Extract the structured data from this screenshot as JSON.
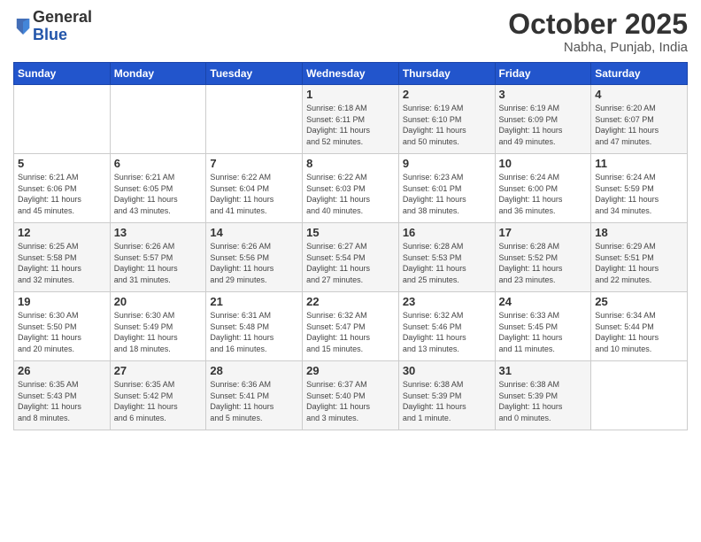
{
  "header": {
    "logo_general": "General",
    "logo_blue": "Blue",
    "month": "October 2025",
    "location": "Nabha, Punjab, India"
  },
  "days_of_week": [
    "Sunday",
    "Monday",
    "Tuesday",
    "Wednesday",
    "Thursday",
    "Friday",
    "Saturday"
  ],
  "weeks": [
    [
      {
        "num": "",
        "info": ""
      },
      {
        "num": "",
        "info": ""
      },
      {
        "num": "",
        "info": ""
      },
      {
        "num": "1",
        "info": "Sunrise: 6:18 AM\nSunset: 6:11 PM\nDaylight: 11 hours\nand 52 minutes."
      },
      {
        "num": "2",
        "info": "Sunrise: 6:19 AM\nSunset: 6:10 PM\nDaylight: 11 hours\nand 50 minutes."
      },
      {
        "num": "3",
        "info": "Sunrise: 6:19 AM\nSunset: 6:09 PM\nDaylight: 11 hours\nand 49 minutes."
      },
      {
        "num": "4",
        "info": "Sunrise: 6:20 AM\nSunset: 6:07 PM\nDaylight: 11 hours\nand 47 minutes."
      }
    ],
    [
      {
        "num": "5",
        "info": "Sunrise: 6:21 AM\nSunset: 6:06 PM\nDaylight: 11 hours\nand 45 minutes."
      },
      {
        "num": "6",
        "info": "Sunrise: 6:21 AM\nSunset: 6:05 PM\nDaylight: 11 hours\nand 43 minutes."
      },
      {
        "num": "7",
        "info": "Sunrise: 6:22 AM\nSunset: 6:04 PM\nDaylight: 11 hours\nand 41 minutes."
      },
      {
        "num": "8",
        "info": "Sunrise: 6:22 AM\nSunset: 6:03 PM\nDaylight: 11 hours\nand 40 minutes."
      },
      {
        "num": "9",
        "info": "Sunrise: 6:23 AM\nSunset: 6:01 PM\nDaylight: 11 hours\nand 38 minutes."
      },
      {
        "num": "10",
        "info": "Sunrise: 6:24 AM\nSunset: 6:00 PM\nDaylight: 11 hours\nand 36 minutes."
      },
      {
        "num": "11",
        "info": "Sunrise: 6:24 AM\nSunset: 5:59 PM\nDaylight: 11 hours\nand 34 minutes."
      }
    ],
    [
      {
        "num": "12",
        "info": "Sunrise: 6:25 AM\nSunset: 5:58 PM\nDaylight: 11 hours\nand 32 minutes."
      },
      {
        "num": "13",
        "info": "Sunrise: 6:26 AM\nSunset: 5:57 PM\nDaylight: 11 hours\nand 31 minutes."
      },
      {
        "num": "14",
        "info": "Sunrise: 6:26 AM\nSunset: 5:56 PM\nDaylight: 11 hours\nand 29 minutes."
      },
      {
        "num": "15",
        "info": "Sunrise: 6:27 AM\nSunset: 5:54 PM\nDaylight: 11 hours\nand 27 minutes."
      },
      {
        "num": "16",
        "info": "Sunrise: 6:28 AM\nSunset: 5:53 PM\nDaylight: 11 hours\nand 25 minutes."
      },
      {
        "num": "17",
        "info": "Sunrise: 6:28 AM\nSunset: 5:52 PM\nDaylight: 11 hours\nand 23 minutes."
      },
      {
        "num": "18",
        "info": "Sunrise: 6:29 AM\nSunset: 5:51 PM\nDaylight: 11 hours\nand 22 minutes."
      }
    ],
    [
      {
        "num": "19",
        "info": "Sunrise: 6:30 AM\nSunset: 5:50 PM\nDaylight: 11 hours\nand 20 minutes."
      },
      {
        "num": "20",
        "info": "Sunrise: 6:30 AM\nSunset: 5:49 PM\nDaylight: 11 hours\nand 18 minutes."
      },
      {
        "num": "21",
        "info": "Sunrise: 6:31 AM\nSunset: 5:48 PM\nDaylight: 11 hours\nand 16 minutes."
      },
      {
        "num": "22",
        "info": "Sunrise: 6:32 AM\nSunset: 5:47 PM\nDaylight: 11 hours\nand 15 minutes."
      },
      {
        "num": "23",
        "info": "Sunrise: 6:32 AM\nSunset: 5:46 PM\nDaylight: 11 hours\nand 13 minutes."
      },
      {
        "num": "24",
        "info": "Sunrise: 6:33 AM\nSunset: 5:45 PM\nDaylight: 11 hours\nand 11 minutes."
      },
      {
        "num": "25",
        "info": "Sunrise: 6:34 AM\nSunset: 5:44 PM\nDaylight: 11 hours\nand 10 minutes."
      }
    ],
    [
      {
        "num": "26",
        "info": "Sunrise: 6:35 AM\nSunset: 5:43 PM\nDaylight: 11 hours\nand 8 minutes."
      },
      {
        "num": "27",
        "info": "Sunrise: 6:35 AM\nSunset: 5:42 PM\nDaylight: 11 hours\nand 6 minutes."
      },
      {
        "num": "28",
        "info": "Sunrise: 6:36 AM\nSunset: 5:41 PM\nDaylight: 11 hours\nand 5 minutes."
      },
      {
        "num": "29",
        "info": "Sunrise: 6:37 AM\nSunset: 5:40 PM\nDaylight: 11 hours\nand 3 minutes."
      },
      {
        "num": "30",
        "info": "Sunrise: 6:38 AM\nSunset: 5:39 PM\nDaylight: 11 hours\nand 1 minute."
      },
      {
        "num": "31",
        "info": "Sunrise: 6:38 AM\nSunset: 5:39 PM\nDaylight: 11 hours\nand 0 minutes."
      },
      {
        "num": "",
        "info": ""
      }
    ]
  ]
}
